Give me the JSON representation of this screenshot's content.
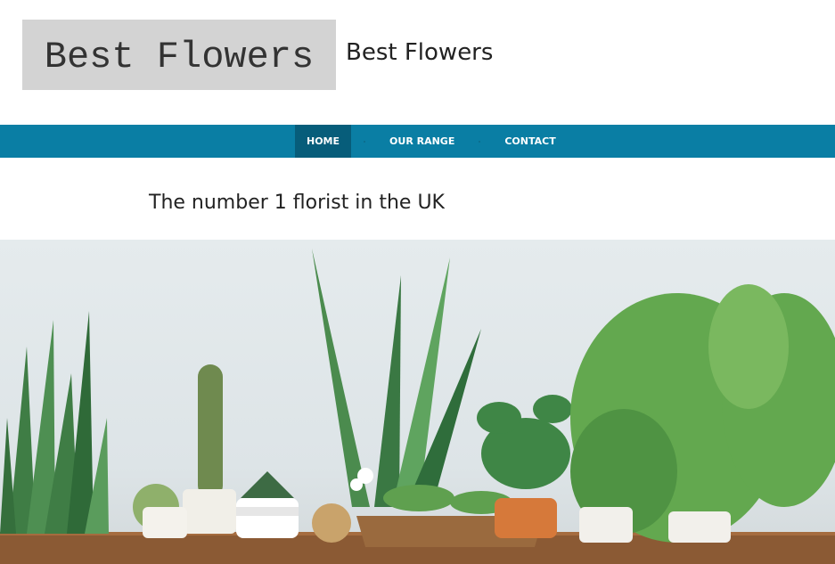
{
  "header": {
    "logo_text": "Best Flowers",
    "site_name": "Best Flowers"
  },
  "nav": {
    "items": [
      {
        "label": "HOME",
        "active": true
      },
      {
        "label": "OUR RANGE",
        "active": false
      },
      {
        "label": "CONTACT",
        "active": false
      }
    ]
  },
  "main": {
    "tagline": "The number 1 florist in the UK"
  },
  "colors": {
    "nav_bg": "#0a7ea4",
    "nav_active_bg": "#075d7a",
    "logo_bg": "#d3d3d3"
  },
  "hero": {
    "icon": "houseplants-photo"
  }
}
